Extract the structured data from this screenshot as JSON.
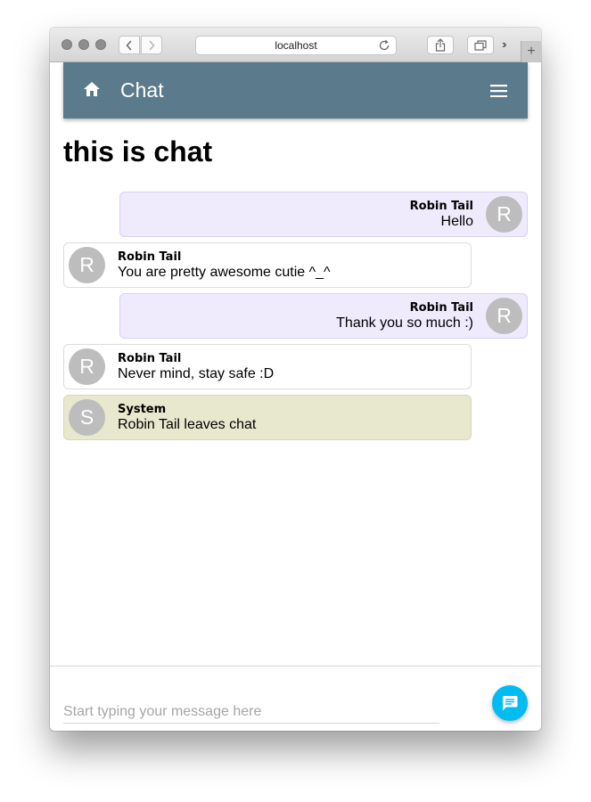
{
  "browser": {
    "url": "localhost",
    "new_tab_label": "+"
  },
  "appbar": {
    "title": "Chat",
    "color": "#5b7b8c"
  },
  "page": {
    "heading": "this is chat"
  },
  "messages": [
    {
      "kind": "mine",
      "author": "Robin Tail",
      "text": "Hello",
      "avatar": "R"
    },
    {
      "kind": "theirs",
      "author": "Robin Tail",
      "text": "You are pretty awesome cutie ^_^",
      "avatar": "R"
    },
    {
      "kind": "mine",
      "author": "Robin Tail",
      "text": "Thank you so much :)",
      "avatar": "R"
    },
    {
      "kind": "theirs",
      "author": "Robin Tail",
      "text": "Never mind, stay safe :D",
      "avatar": "R"
    },
    {
      "kind": "system",
      "author": "System",
      "text": "Robin Tail leaves chat",
      "avatar": "S"
    }
  ],
  "composer": {
    "placeholder": "Start typing your message here",
    "value": ""
  },
  "icons": {
    "home": "home-icon",
    "menu": "hamburger-menu-icon",
    "send": "chat-bubble-icon"
  },
  "colors": {
    "own_message_bg": "#efebfd",
    "system_message_bg": "#e8e8cf",
    "fab": "#00bcf2",
    "avatar": "#bdbdbd"
  }
}
